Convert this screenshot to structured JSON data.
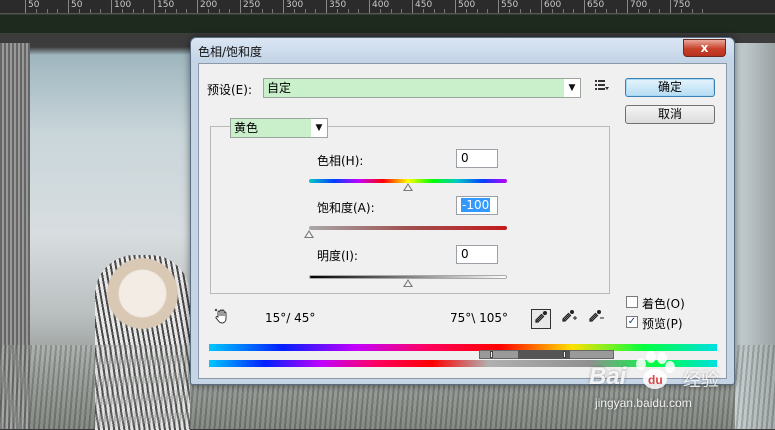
{
  "ruler": {
    "labels": [
      "50",
      "50",
      "100",
      "150",
      "200",
      "250",
      "300",
      "350",
      "400",
      "450",
      "500",
      "550",
      "600",
      "650",
      "700",
      "750"
    ]
  },
  "dialog": {
    "title": "色相/饱和度",
    "close_glyph": "x",
    "preset_label": "预设(E):",
    "preset_value": "自定",
    "preset_menu_icon": "list-options-icon",
    "ok_label": "确定",
    "cancel_label": "取消",
    "channel_value": "黄色",
    "hue_label": "色相(H):",
    "hue_value": "0",
    "saturation_label": "饱和度(A):",
    "saturation_value": "-100",
    "lightness_label": "明度(I):",
    "lightness_value": "0",
    "range_left": "15°/ 45°",
    "range_right": "75°\\ 105°",
    "colorize_label": "着色(O)",
    "colorize_checked": false,
    "preview_label": "预览(P)",
    "preview_checked": true,
    "hue_slider_level": 0.5,
    "saturation_slider_level": 0.0,
    "lightness_slider_level": 0.5
  },
  "watermark": {
    "brand": "Bai",
    "brand2": "du",
    "suffix": "经验",
    "url": "jingyan.baidu.com"
  }
}
